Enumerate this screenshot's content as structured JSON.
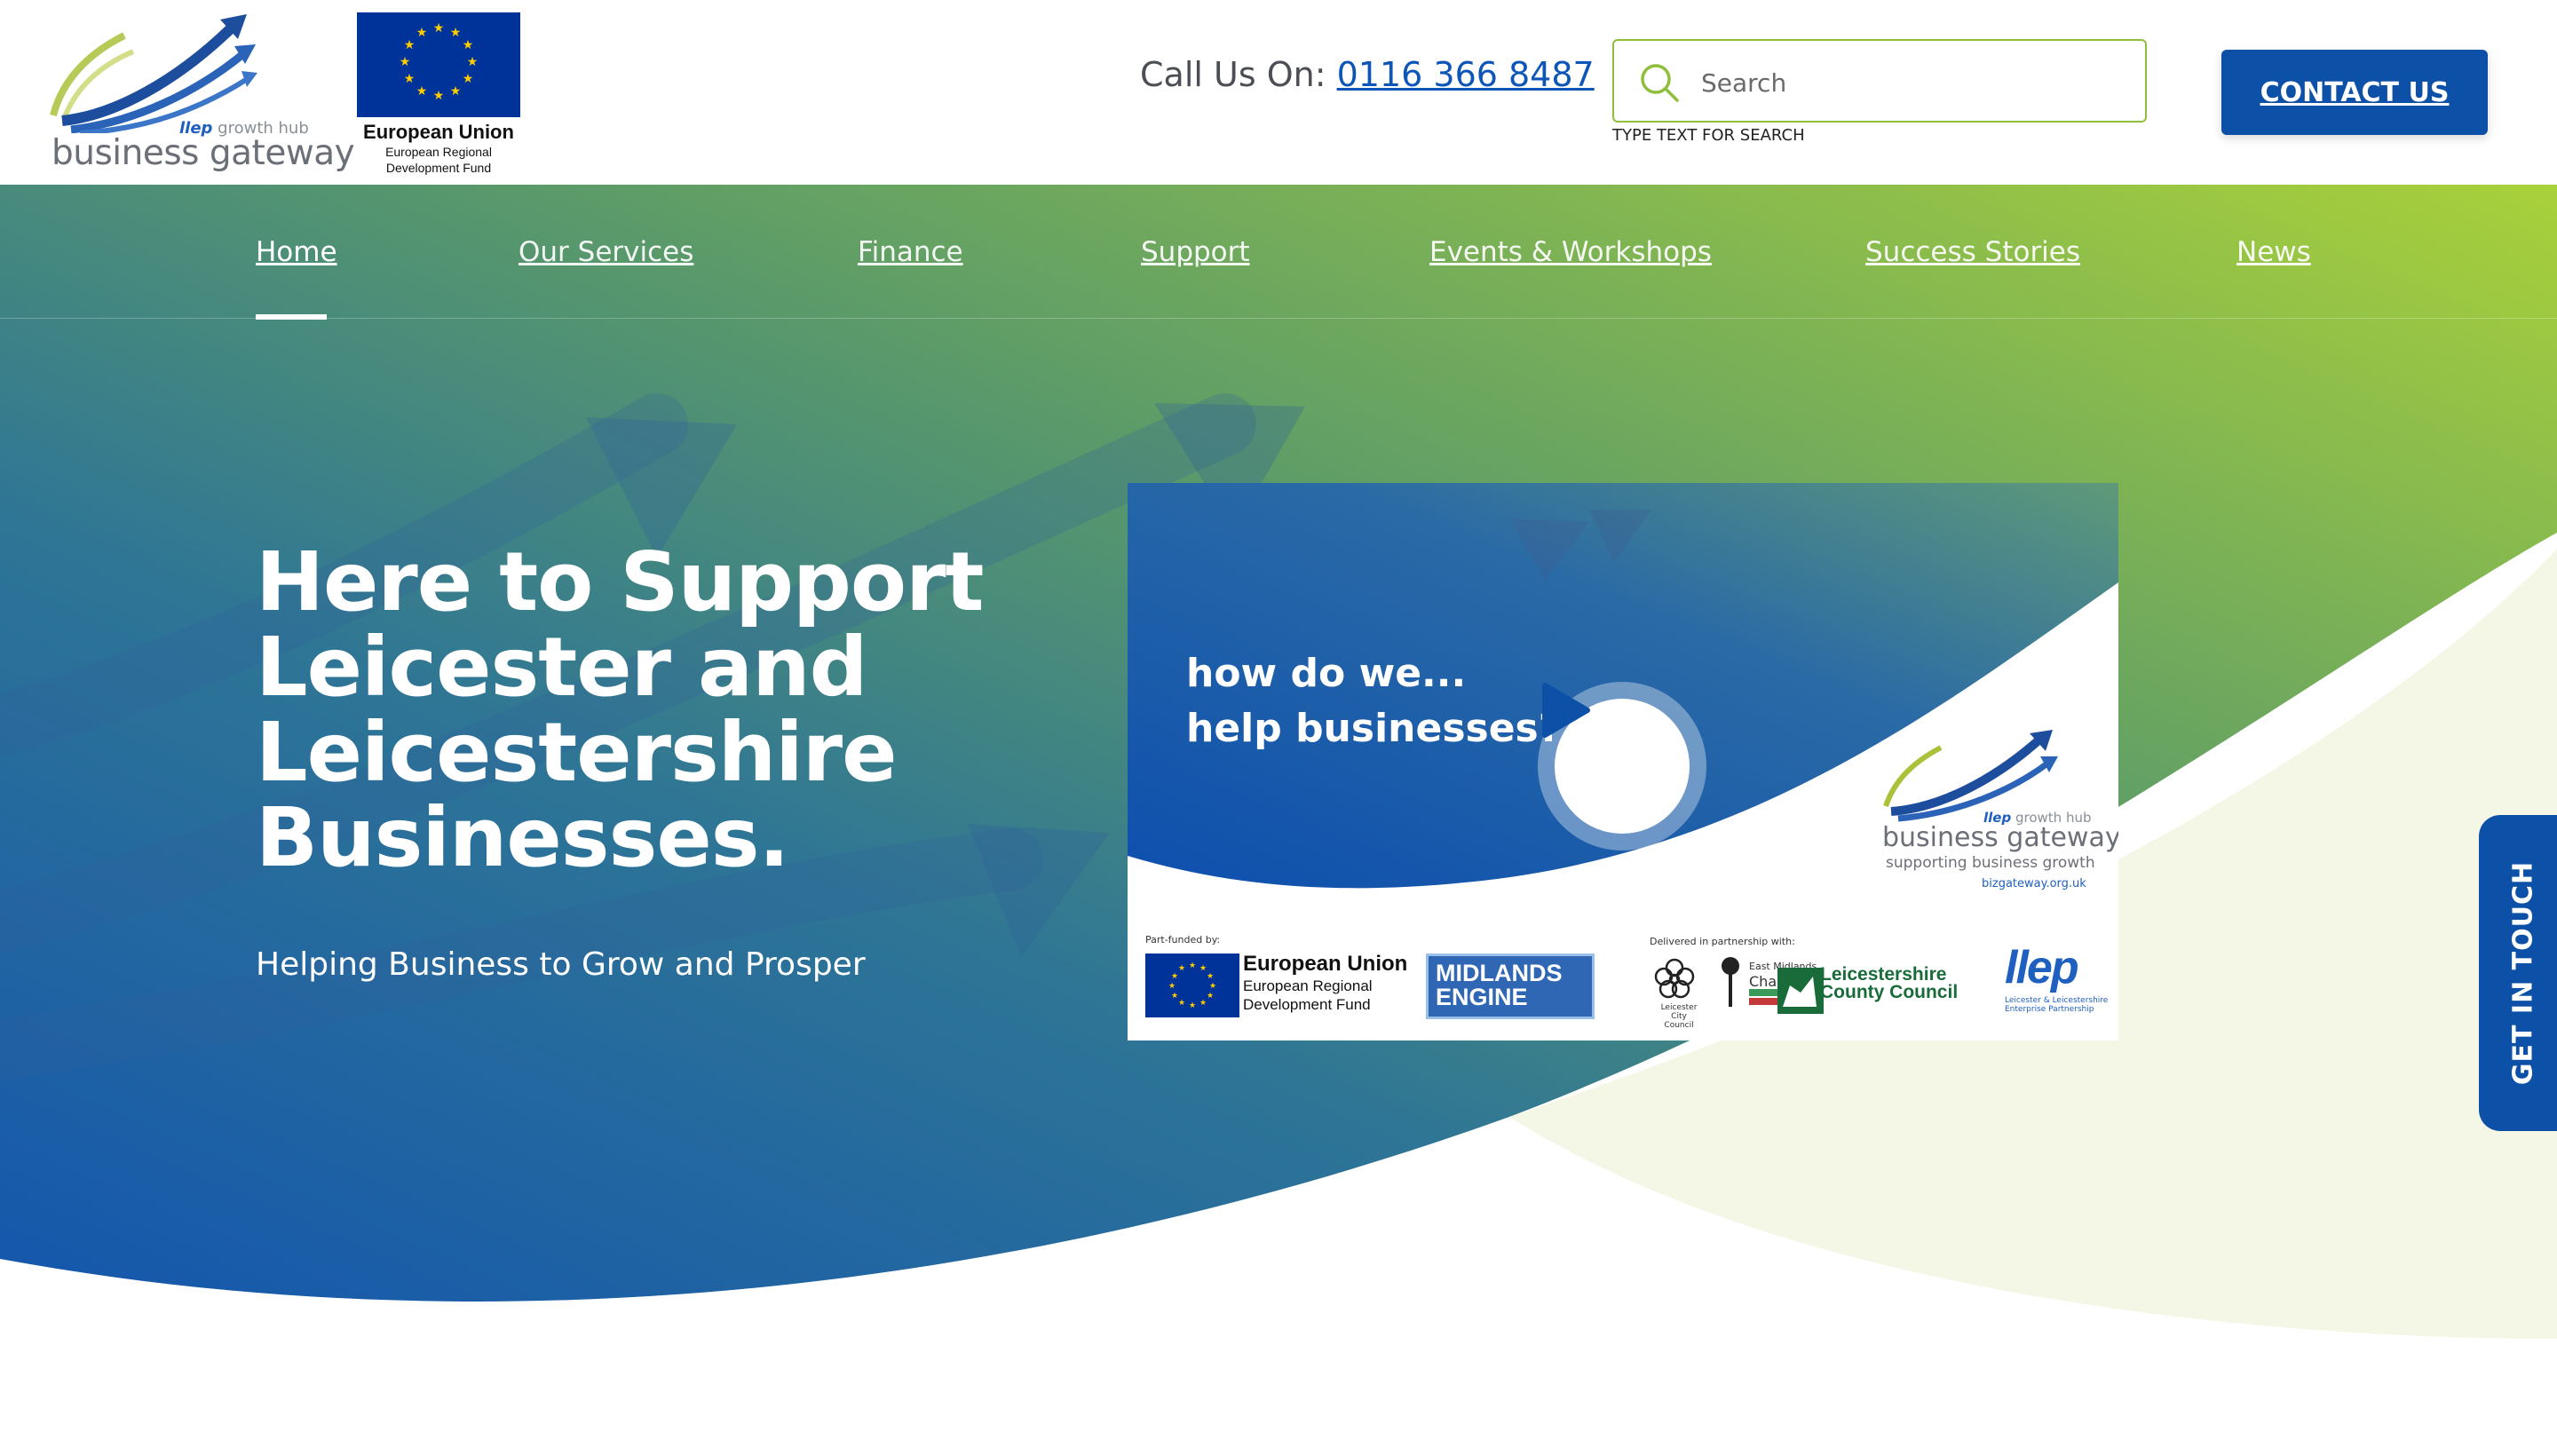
{
  "header": {
    "brand": {
      "hub_prefix": "llep",
      "hub_suffix": "growth hub",
      "name": "business gateway"
    },
    "eu_logo": {
      "title": "European Union",
      "subtitle_1": "European Regional",
      "subtitle_2": "Development Fund"
    },
    "call_us": {
      "label": "Call Us On:",
      "phone": "0116 366 8487"
    },
    "search": {
      "placeholder": "Search",
      "hint": "TYPE TEXT FOR SEARCH",
      "icon": "search-icon"
    },
    "contact_button": "CONTACT US"
  },
  "nav": {
    "items": [
      {
        "label": "Home",
        "active": true
      },
      {
        "label": "Our Services"
      },
      {
        "label": "Finance"
      },
      {
        "label": "Support"
      },
      {
        "label": "Events & Workshops"
      },
      {
        "label": "Success Stories"
      },
      {
        "label": "News"
      }
    ]
  },
  "hero": {
    "title_lines": [
      "Here to Support",
      "Leicester and",
      "Leicestershire",
      "Businesses."
    ],
    "subtitle": "Helping Business to Grow and Prosper"
  },
  "video": {
    "question_line_1": "how do we...",
    "question_line_2": "help businesses?",
    "play_icon": "play-icon",
    "logo": {
      "hub_prefix": "llep",
      "hub_suffix": "growth hub",
      "name": "business gateway",
      "tagline": "supporting business growth",
      "url": "bizgateway.org.uk"
    },
    "partners": {
      "part_funded_label": "Part-funded by:",
      "delivered_label": "Delivered in partnership with:",
      "eu_title": "European Union",
      "eu_sub_1": "European Regional",
      "eu_sub_2": "Development Fund",
      "midlands_1": "MIDLANDS",
      "midlands_2": "ENGINE",
      "city_council": "Leicester City Council",
      "chamber_1": "East Midlands",
      "chamber_2": "Chamber",
      "county_1": "Leicestershire",
      "county_2": "County Council",
      "llep": "llep",
      "llep_sub_1": "Leicester & Leicestershire",
      "llep_sub_2": "Enterprise Partnership"
    }
  },
  "side_tab": "GET IN TOUCH",
  "colors": {
    "primary_blue": "#0d50a8",
    "accent_green": "#8fbf3a",
    "gradient_start": "#1f5fb0",
    "gradient_end": "#a5d03a"
  }
}
